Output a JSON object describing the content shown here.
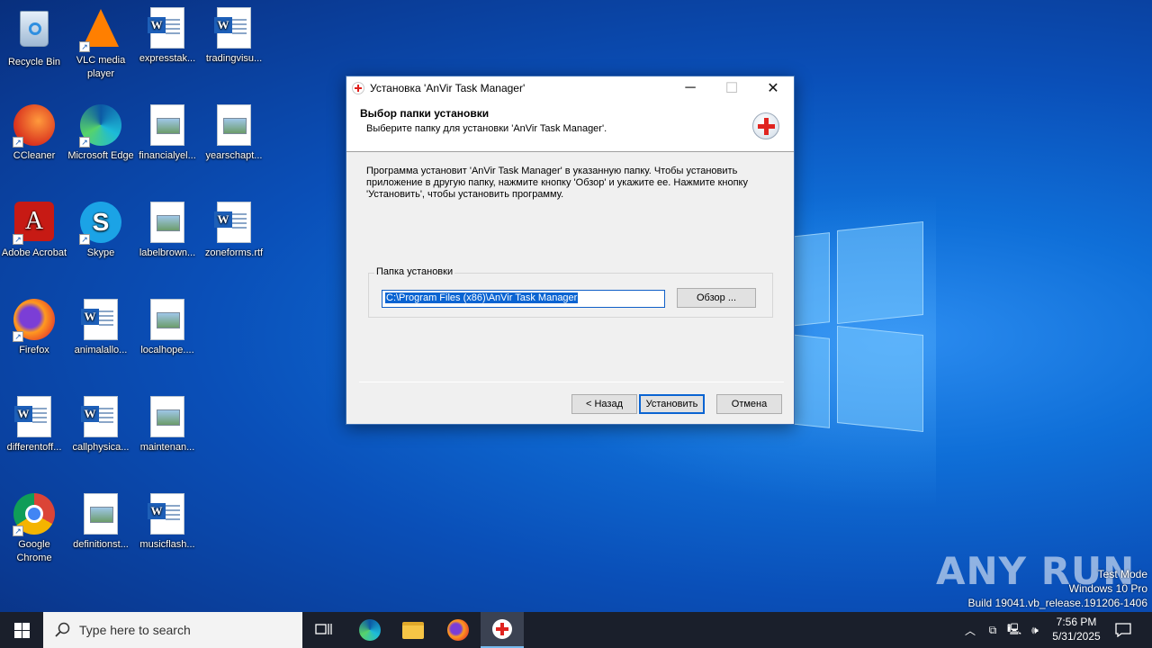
{
  "desktop": {
    "icons": [
      {
        "label": "Recycle Bin"
      },
      {
        "label": "VLC media player"
      },
      {
        "label": "expresstak..."
      },
      {
        "label": "tradingvisu..."
      },
      {
        "label": "CCleaner"
      },
      {
        "label": "Microsoft Edge"
      },
      {
        "label": "financialyel..."
      },
      {
        "label": "yearschapt..."
      },
      {
        "label": "Adobe Acrobat"
      },
      {
        "label": "Skype"
      },
      {
        "label": "labelbrown..."
      },
      {
        "label": "zoneforms.rtf"
      },
      {
        "label": "Firefox"
      },
      {
        "label": "animalallo..."
      },
      {
        "label": "localhope...."
      },
      {
        "label": "differentoff..."
      },
      {
        "label": "callphysica..."
      },
      {
        "label": "maintenan..."
      },
      {
        "label": "Google Chrome"
      },
      {
        "label": "definitionst..."
      },
      {
        "label": "musicflash..."
      }
    ]
  },
  "dialog": {
    "title": "Установка 'AnVir Task Manager'",
    "header_title": "Выбор папки установки",
    "header_subtitle": "Выберите папку для установки 'AnVir Task Manager'.",
    "body_text": "Программа установит 'AnVir Task Manager' в указанную папку. Чтобы установить приложение в другую папку, нажмите кнопку 'Обзор' и укажите ее. Нажмите кнопку 'Установить', чтобы установить программу.",
    "group_label": "Папка установки",
    "path_value": "C:\\Program Files (x86)\\AnVir Task Manager",
    "browse_label": "Обзор ...",
    "back_label": "< Назад",
    "install_label": "Установить",
    "cancel_label": "Отмена"
  },
  "taskbar": {
    "search_placeholder": "Type here to search",
    "time": "7:56 PM",
    "date": "5/31/2025"
  },
  "watermark": {
    "brand": "ANY RUN",
    "line1": "Test Mode",
    "line2": "Windows 10 Pro",
    "line3": "Build 19041.vb_release.191206-1406"
  },
  "colors": {
    "accent": "#0a64d2",
    "taskbar": "#1a1f2b",
    "wallpaper": "#0a4fb8"
  }
}
